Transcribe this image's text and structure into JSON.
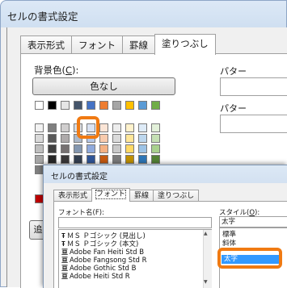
{
  "back_dialog": {
    "title": "セルの書式設定",
    "tabs": [
      {
        "label": "表示形式",
        "active": false
      },
      {
        "label": "フォント",
        "active": false
      },
      {
        "label": "罫線",
        "active": false
      },
      {
        "label": "塗りつぶし",
        "active": true
      }
    ],
    "background_color_label": "背景色(",
    "background_color_key": "C",
    "background_color_label_end": "):",
    "no_color_button": "色なし",
    "pattern_color_label": "パター",
    "pattern_style_label": "パター",
    "ok_button_fragment": "追",
    "palette": {
      "row1": [
        "#ffffff",
        "#000000",
        "#e6e6e6",
        "#44546a",
        "#4472c4",
        "#ed7d31",
        "#a5a5a5",
        "#ffc000",
        "#5b9bd5",
        "#70ad47"
      ],
      "rows": [
        [
          "#f2f2f2",
          "#7f7f7f",
          "#d0cece",
          "#d6dce4",
          "#dae3f3",
          "#fbe5d6",
          "#ededed",
          "#fff2cc",
          "#deebf7",
          "#e2f0d9"
        ],
        [
          "#d9d9d9",
          "#595959",
          "#aeaaaa",
          "#acb9ca",
          "#b4c7e7",
          "#f8cbad",
          "#dbdbdb",
          "#ffe699",
          "#bdd7ee",
          "#c5e0b4"
        ],
        [
          "#bfbfbf",
          "#404040",
          "#767171",
          "#8497b0",
          "#8faadc",
          "#f4b183",
          "#c9c9c9",
          "#ffd966",
          "#9dc3e6",
          "#a9d18e"
        ],
        [
          "#a6a6a6",
          "#262626",
          "#3a3838",
          "#333f50",
          "#2f5597",
          "#c55a11",
          "#7b7b7b",
          "#bf9000",
          "#2e75b6",
          "#548235"
        ],
        [
          "#808080",
          "#0d0d0d",
          "#171616",
          "#222a35",
          "#1f3864",
          "#843c0c",
          "#525252",
          "#7f6000",
          "#1f4e79",
          "#385723"
        ]
      ],
      "standard_first": "#c00000",
      "selected_color": "#d0cece"
    }
  },
  "front_dialog": {
    "title": "セルの書式設定",
    "tabs": [
      {
        "label": "表示形式",
        "active": false
      },
      {
        "label": "フォント",
        "active": true
      },
      {
        "label": "罫線",
        "active": false
      },
      {
        "label": "塗りつぶし",
        "active": false
      }
    ],
    "font_name_label": "フォント名(F):",
    "font_name_value": "",
    "font_list": [
      {
        "glyph": "Ŧ",
        "name": "ＭＳ Ｐゴシック (見出し)"
      },
      {
        "glyph": "Ŧ",
        "name": "ＭＳ Ｐゴシック (本文)"
      },
      {
        "glyph": "亘",
        "name": "Adobe Fan Heiti Std B"
      },
      {
        "glyph": "亘",
        "name": "Adobe Fangsong Std R"
      },
      {
        "glyph": "亘",
        "name": "Adobe Gothic Std B"
      },
      {
        "glyph": "亘",
        "name": "Adobe Heiti Std R"
      }
    ],
    "style_label": "スタイル(",
    "style_key": "O",
    "style_label_end": "):",
    "style_value": "太字",
    "style_list": [
      "標準",
      "斜体",
      "太字"
    ],
    "style_selected": "太字"
  },
  "accent_color": "#f07a12"
}
